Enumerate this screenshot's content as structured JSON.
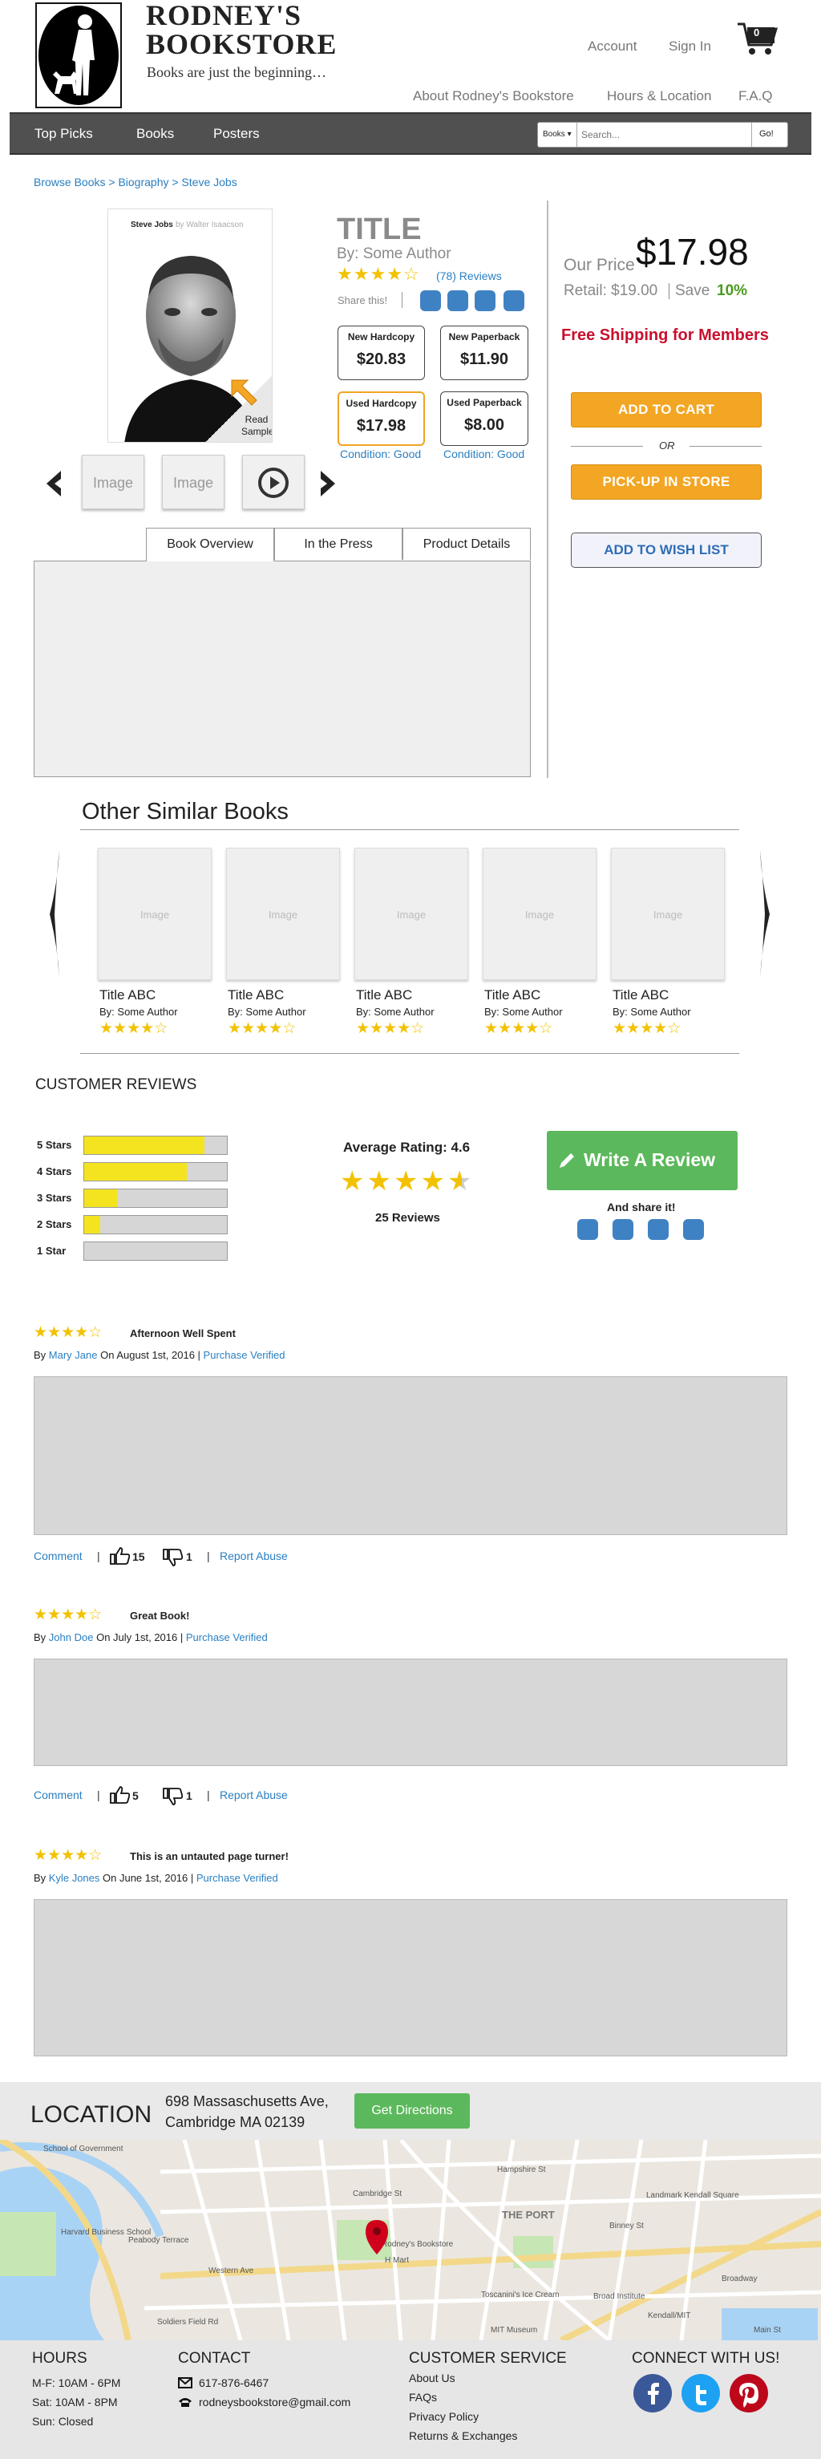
{
  "header": {
    "brand_line1": "RODNEY'S",
    "brand_line2": "BOOKSTORE",
    "tagline": "Books are just the beginning…",
    "account": "Account",
    "sign_in": "Sign In",
    "cart_count": "0",
    "links": [
      "About Rodney's Bookstore",
      "Hours & Location",
      "F.A.Q"
    ]
  },
  "nav": {
    "items": [
      "Top Picks",
      "Books",
      "Posters"
    ],
    "search_category": "Books ▾",
    "search_placeholder": "Search...",
    "search_button": "Go!"
  },
  "breadcrumb": "Browse Books > Biography > Steve Jobs",
  "product": {
    "cover_title": "Steve Jobs",
    "cover_author": "by Walter Isaacson",
    "read_sample": "Read Sample",
    "title": "TITLE",
    "author": "By: Some Author",
    "rating_stars": 4,
    "reviews_link": "(78) Reviews",
    "share_label": "Share this!",
    "thumb_labels": [
      "Image",
      "Image"
    ],
    "formats": [
      {
        "name": "New Hardcopy",
        "price": "$20.83",
        "condition": ""
      },
      {
        "name": "New Paperback",
        "price": "$11.90",
        "condition": ""
      },
      {
        "name": "Used Hardcopy",
        "price": "$17.98",
        "condition": "Condition: Good"
      },
      {
        "name": "Used Paperback",
        "price": "$8.00",
        "condition": "Condition: Good"
      }
    ],
    "our_price_label": "Our Price",
    "our_price": "$17.98",
    "retail": "Retail: $19.00",
    "save_label": "Save",
    "save_pct": "10%",
    "free_shipping": "Free Shipping for Members",
    "add_to_cart": "ADD TO CART",
    "or": "OR",
    "pickup": "PICK-UP IN STORE",
    "wishlist": "ADD TO WISH LIST"
  },
  "tabs": [
    "Book Overview",
    "In the Press",
    "Product Details"
  ],
  "similar": {
    "heading": "Other Similar Books",
    "books": [
      {
        "image": "Image",
        "title": "Title ABC",
        "author": "By: Some Author"
      },
      {
        "image": "Image",
        "title": "Title ABC",
        "author": "By: Some Author"
      },
      {
        "image": "Image",
        "title": "Title ABC",
        "author": "By: Some Author"
      },
      {
        "image": "Image",
        "title": "Title ABC",
        "author": "By: Some Author"
      },
      {
        "image": "Image",
        "title": "Title ABC",
        "author": "By: Some Author"
      }
    ]
  },
  "reviews_section": {
    "heading": "CUSTOMER REVIEWS",
    "breakdown": [
      {
        "label": "5 Stars",
        "fraction": 0.84
      },
      {
        "label": "4 Stars",
        "fraction": 0.72
      },
      {
        "label": "3 Stars",
        "fraction": 0.23
      },
      {
        "label": "2 Stars",
        "fraction": 0.11
      },
      {
        "label": "1 Star",
        "fraction": 0
      }
    ],
    "average_label": "Average Rating: 4.6",
    "review_count": "25 Reviews",
    "write_review": "Write A Review",
    "and_share": "And share it!"
  },
  "reviews": [
    {
      "stars": 4,
      "title": "Afternoon Well Spent",
      "by": "By",
      "author": "Mary Jane",
      "date": "On August 1st, 2016",
      "verified": "Purchase Verified",
      "comment": "Comment",
      "likes": "15",
      "dislikes": "1",
      "report": "Report Abuse"
    },
    {
      "stars": 4,
      "title": "Great Book!",
      "by": "By",
      "author": "John Doe",
      "date": "On July 1st, 2016",
      "verified": "Purchase Verified",
      "comment": "Comment",
      "likes": "5",
      "dislikes": "1",
      "report": "Report Abuse"
    },
    {
      "stars": 4,
      "title": "This is an untauted page turner!",
      "by": "By",
      "author": "Kyle Jones",
      "date": "On June 1st, 2016",
      "verified": "Purchase Verified"
    }
  ],
  "location": {
    "heading": "LOCATION",
    "address1": "698 Massaschusetts Ave,",
    "address2": "Cambridge MA 02139",
    "directions": "Get Directions",
    "map_labels": [
      "School of Government",
      "Harvard Business School",
      "Peabody Terrace",
      "Rodney's Bookstore",
      "H Mart",
      "THE PORT",
      "Landmark Kendall Square",
      "Toscanini's Ice Cream",
      "Broad Institute",
      "MIT Museum",
      "Kendall/MIT",
      "Main St",
      "Western Ave",
      "Broadway",
      "Hampshire St",
      "Cambridge St",
      "Soldiers Field Rd",
      "Binney St"
    ]
  },
  "footer": {
    "hours_heading": "HOURS",
    "hours": [
      "M-F: 10AM - 6PM",
      "Sat: 10AM - 8PM",
      "Sun: Closed"
    ],
    "contact_heading": "CONTACT",
    "phone": "617-876-6467",
    "email": "rodneysbookstore@gmail.com",
    "service_heading": "CUSTOMER SERVICE",
    "service_links": [
      "About Us",
      "FAQs",
      "Privacy Policy",
      "Returns & Exchanges"
    ],
    "connect_heading": "CONNECT WITH US!"
  },
  "colors": {
    "accent_blue": "#2a7fc1",
    "orange": "#f3a623",
    "green": "#5cb85c",
    "red": "#c8102e",
    "nav_gray": "#505050"
  }
}
